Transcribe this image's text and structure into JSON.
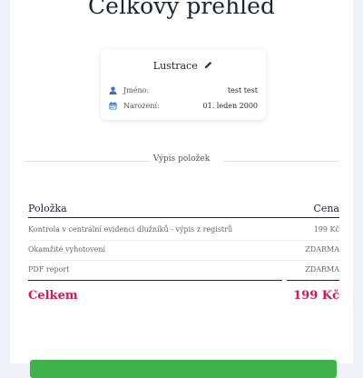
{
  "header": {
    "title": "Celkový přehled"
  },
  "card": {
    "title": "Lustrace",
    "rows": [
      {
        "icon": "user-icon",
        "label": "Jméno:",
        "value": "test test"
      },
      {
        "icon": "calendar-icon",
        "label": "Narození:",
        "value": "01. leden 2000"
      }
    ]
  },
  "summary": {
    "divider_label": "Výpis položek",
    "columns": {
      "item": "Položka",
      "price": "Cena"
    },
    "items": [
      {
        "name": "Kontrola v centrální evidenci dlužníků - výpis z registrů",
        "price": "199 Kč"
      },
      {
        "name": "Okamžité vyhotovení",
        "price": "ZDARMA"
      },
      {
        "name": "PDF report",
        "price": "ZDARMA"
      }
    ],
    "total_label": "Celkem",
    "total_price": "199 Kč"
  },
  "colors": {
    "accent": "#d6194f",
    "button": "#3fb24c",
    "icon": "#3a6fc4"
  }
}
